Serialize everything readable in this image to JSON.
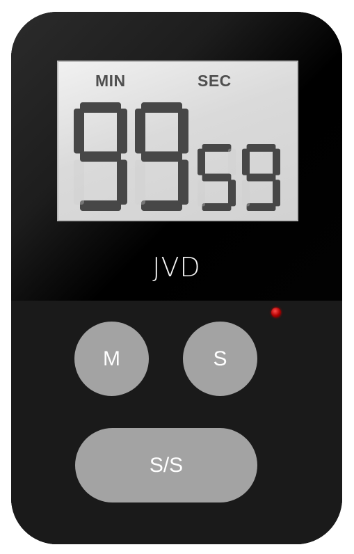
{
  "device": {
    "brand": "JVD",
    "led_color": "#c00000"
  },
  "display": {
    "min_label": "MIN",
    "sec_label": "SEC",
    "minutes": "99",
    "seconds": "59"
  },
  "buttons": {
    "m_label": "M",
    "s_label": "S",
    "ss_label": "S/S"
  }
}
